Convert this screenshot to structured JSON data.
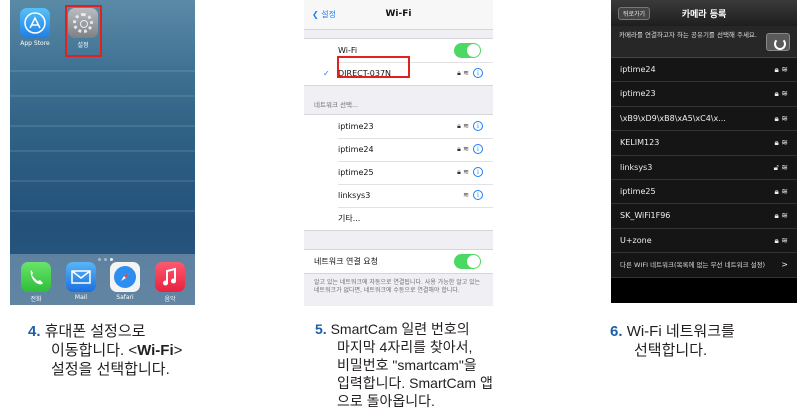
{
  "panel1": {
    "apps_top": [
      {
        "label": "App Store",
        "icon": "app-store-icon"
      },
      {
        "label": "설정",
        "icon": "settings-gear-icon"
      }
    ],
    "dock": [
      {
        "label": "전화",
        "icon": "phone-icon"
      },
      {
        "label": "Mail",
        "icon": "mail-icon"
      },
      {
        "label": "Safari",
        "icon": "safari-compass-icon"
      },
      {
        "label": "음악",
        "icon": "music-note-icon"
      }
    ]
  },
  "panel2": {
    "back": "설정",
    "title": "Wi-Fi",
    "wifi_label": "Wi-Fi",
    "connected": "DIRECT-037N",
    "choose_header": "네트워크 선택...",
    "networks": [
      {
        "name": "iptime23",
        "locked": true
      },
      {
        "name": "iptime24",
        "locked": true
      },
      {
        "name": "iptime25",
        "locked": true
      },
      {
        "name": "linksys3",
        "locked": false
      }
    ],
    "other": "기타...",
    "ask_label": "네트워크 연결 요청",
    "footer": "알고 있는 네트워크에 자동으로 연결됩니다. 사용 가능한 알고 있는 네트워크가 없다면, 네트워크에 수동으로 연결해야 합니다."
  },
  "panel3": {
    "back": "뒤로가기",
    "title": "카메라 등록",
    "info": "카메라를 연결하고자 하는 공유기를 선택해 주세요.",
    "networks": [
      {
        "name": "iptime24",
        "locked": true
      },
      {
        "name": "iptime23",
        "locked": true
      },
      {
        "name": "\\xB9\\xD9\\xB8\\xA5\\xC4\\x...",
        "locked": true
      },
      {
        "name": "KELIM123",
        "locked": true
      },
      {
        "name": "linksys3",
        "locked": false
      },
      {
        "name": "iptime25",
        "locked": true
      },
      {
        "name": "SK_WiFi1F96",
        "locked": true
      },
      {
        "name": "U+zone",
        "locked": true
      }
    ],
    "other": "다른 WIFI 네트워크(목록에 없는 무선 네트워크 설정)"
  },
  "captions": {
    "c4_num": "4.",
    "c4_l1": "휴대폰 설정으로",
    "c4_l2a": "이동합니다. <",
    "c4_l2b": "Wi-Fi",
    "c4_l2c": ">",
    "c4_l3": "설정을 선택합니다.",
    "c5_num": "5.",
    "c5_l1": "SmartCam 일련 번호의",
    "c5_l2": "마지막 4자리를 찾아서,",
    "c5_l3": "비밀번호 \"smartcam\"을",
    "c5_l4": "입력합니다. SmartCam 앱",
    "c5_l5": "으로 돌아옵니다.",
    "c6_num": "6.",
    "c6_l1": "Wi-Fi 네트워크를",
    "c6_l2": "선택합니다."
  },
  "colors": {
    "highlight": "#e0211d",
    "step_number": "#1b5fa8",
    "ios_blue": "#1d7ff5",
    "toggle_on": "#4bd863"
  }
}
